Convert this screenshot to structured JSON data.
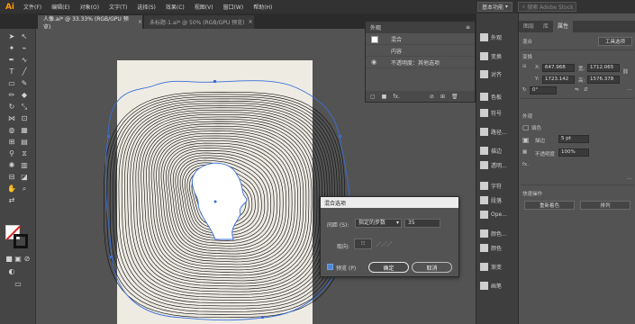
{
  "app": {
    "logo": "Ai"
  },
  "menu": [
    "文件(F)",
    "编辑(E)",
    "对象(O)",
    "文字(T)",
    "选择(S)",
    "效果(C)",
    "视图(V)",
    "窗口(W)",
    "帮助(H)"
  ],
  "workspace": {
    "label": "基本功能",
    "search_placeholder": "搜索 Adobe Stock"
  },
  "tabs": [
    {
      "label": "人像.ai* @ 33.33% (RGB/GPU 预览)",
      "active": true
    },
    {
      "label": "未标题-1.ai* @ 50% (RGB/GPU 预览)",
      "active": false
    }
  ],
  "appearance_panel": {
    "title": "外观",
    "rows": [
      "混合",
      "内容",
      "不透明度：其他选项"
    ],
    "footer": [
      "▢",
      "■",
      "fx.",
      "⊘",
      "⊞",
      "🗑"
    ]
  },
  "dock_items": [
    "外观",
    "变换",
    "对齐",
    "色板",
    "符号",
    "路径...",
    "描边",
    "透明...",
    "字符",
    "段落",
    "Ope...",
    "颜色...",
    "颜色",
    "渐变",
    "画笔"
  ],
  "properties_panel": {
    "tabs": [
      "图层",
      "库",
      "属性"
    ],
    "section_mix": "混合",
    "tool_options_button": "工具选项",
    "section_transform": "变换",
    "x_label": "X:",
    "x_value": "647.968",
    "y_label": "Y:",
    "y_value": "1723.142",
    "w_label": "宽:",
    "w_value": "1712.065",
    "h_label": "高:",
    "h_value": "1576.378",
    "angle_value": "0°",
    "section_appearance": "外观",
    "fill_label": "填色",
    "stroke_label": "描边",
    "stroke_value": "5 pt",
    "opacity_label": "不透明度",
    "opacity_value": "100%",
    "fx_label": "fx.",
    "section_quick": "快速操作",
    "reset_button": "重新着色",
    "arrange_button": "排列"
  },
  "blend_dialog": {
    "title": "混合选项",
    "spacing_label": "间距 (S):",
    "spacing_mode": "指定的步数",
    "spacing_value": "35",
    "orientation_label": "取向:",
    "preview_label": "预览 (P)",
    "ok_label": "确定",
    "cancel_label": "取消"
  },
  "colors": {
    "accent": "#2f6fdb",
    "path": "#3a6fd8"
  }
}
